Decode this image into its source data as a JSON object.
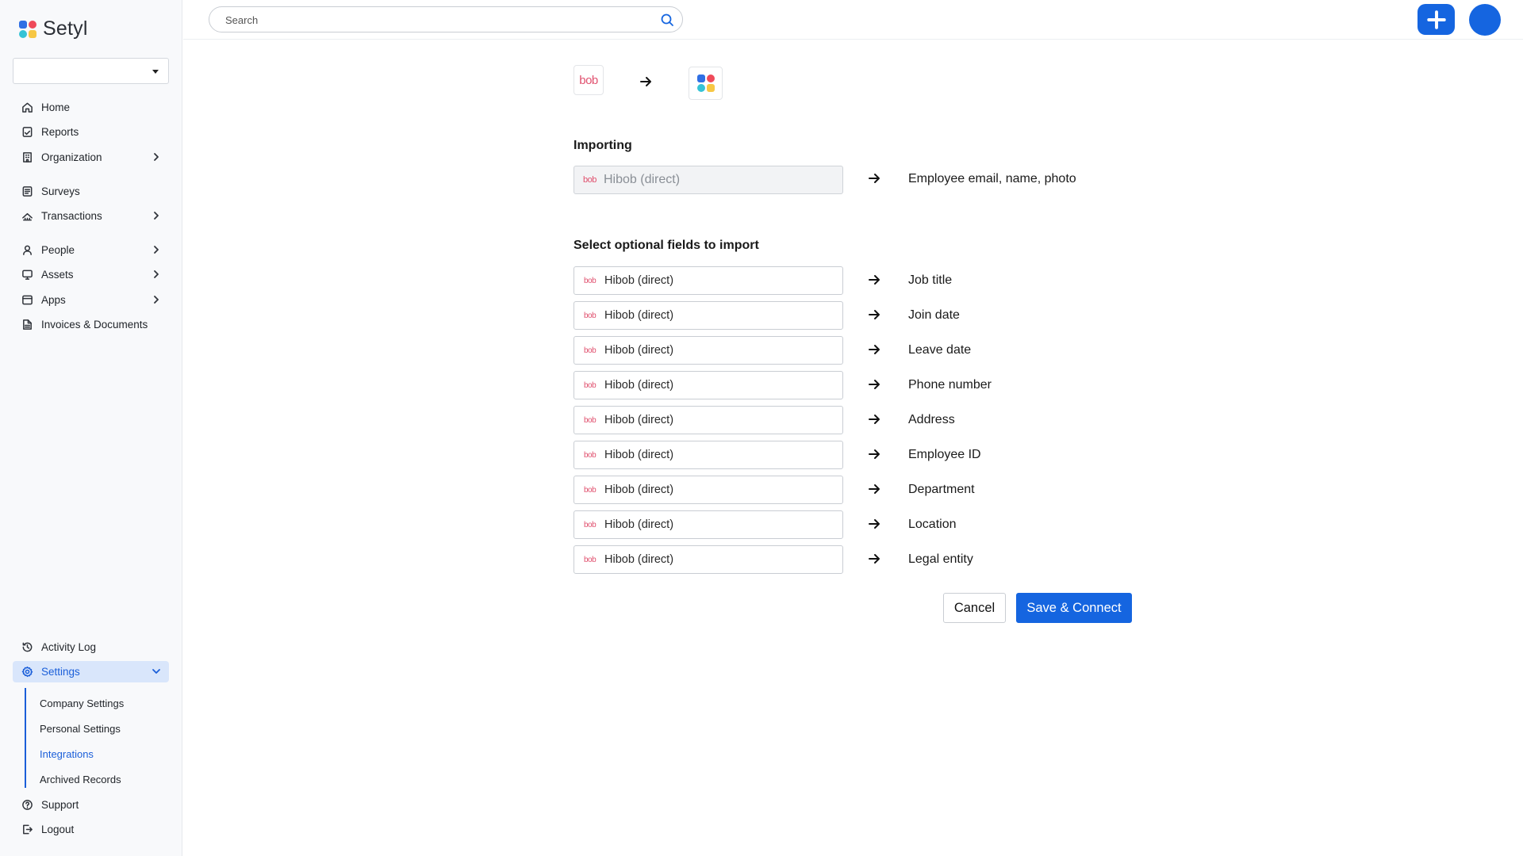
{
  "brand": {
    "name": "Setyl",
    "colors": [
      "#2f6fe4",
      "#ef4a5a",
      "#35c3d6",
      "#f7c744"
    ]
  },
  "org_select": {
    "value": ""
  },
  "nav_top": [
    {
      "label": "Home",
      "icon": "home-icon",
      "chevron": false
    },
    {
      "label": "Reports",
      "icon": "reports-icon",
      "chevron": false
    },
    {
      "label": "Organization",
      "icon": "building-icon",
      "chevron": true
    },
    {
      "label": "Surveys",
      "icon": "survey-icon",
      "chevron": false
    },
    {
      "label": "Transactions",
      "icon": "transactions-icon",
      "chevron": true
    },
    {
      "label": "People",
      "icon": "person-icon",
      "chevron": true
    },
    {
      "label": "Assets",
      "icon": "monitor-icon",
      "chevron": true
    },
    {
      "label": "Apps",
      "icon": "apps-icon",
      "chevron": true
    },
    {
      "label": "Invoices & Documents",
      "icon": "invoice-icon",
      "chevron": false
    }
  ],
  "nav_bottom": {
    "activity_log": "Activity Log",
    "settings": "Settings",
    "settings_sub": [
      "Company Settings",
      "Personal Settings",
      "Integrations",
      "Archived Records"
    ],
    "active_sub": "Integrations",
    "support": "Support",
    "logout": "Logout"
  },
  "search": {
    "placeholder": "Search"
  },
  "integration": {
    "source_logo_text": "bob",
    "source_logo_color": "#e0506e"
  },
  "importing": {
    "title": "Importing",
    "source": "Hibob (direct)",
    "target": "Employee email, name, photo"
  },
  "optional": {
    "title": "Select optional fields to import",
    "rows": [
      {
        "source": "Hibob (direct)",
        "target": "Job title"
      },
      {
        "source": "Hibob (direct)",
        "target": "Join date"
      },
      {
        "source": "Hibob (direct)",
        "target": "Leave date"
      },
      {
        "source": "Hibob (direct)",
        "target": "Phone number"
      },
      {
        "source": "Hibob (direct)",
        "target": "Address"
      },
      {
        "source": "Hibob (direct)",
        "target": "Employee ID"
      },
      {
        "source": "Hibob (direct)",
        "target": "Department"
      },
      {
        "source": "Hibob (direct)",
        "target": "Location"
      },
      {
        "source": "Hibob (direct)",
        "target": "Legal entity"
      }
    ]
  },
  "actions": {
    "cancel": "Cancel",
    "save": "Save & Connect"
  },
  "colors": {
    "accent": "#1565e0",
    "active_bg": "#d9e6fb"
  }
}
